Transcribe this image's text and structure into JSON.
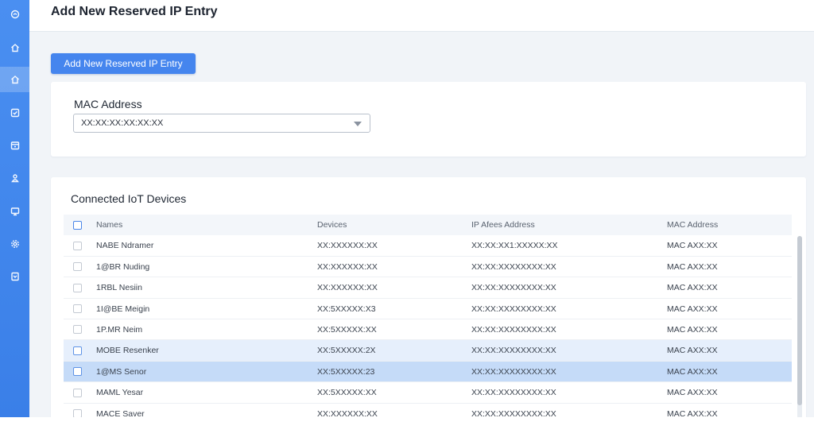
{
  "page": {
    "title": "Add New Reserved IP Entry"
  },
  "sidebar": {
    "items": [
      {
        "icon": "logo-icon"
      },
      {
        "icon": "home-icon"
      },
      {
        "icon": "network-icon",
        "active": true
      },
      {
        "icon": "checkbox-icon"
      },
      {
        "icon": "calendar-icon"
      },
      {
        "icon": "user-icon"
      },
      {
        "icon": "monitor-icon"
      },
      {
        "icon": "gear-icon"
      },
      {
        "icon": "document-icon"
      }
    ]
  },
  "toolbar": {
    "add_label": "Add New Reserved IP Entry"
  },
  "mac_form": {
    "label": "MAC Address",
    "selected_value": "XX:XX:XX:XX:XX:XX"
  },
  "devices": {
    "title": "Connected IoT Devices",
    "columns": [
      "Names",
      "Devices",
      "IP Afees Address",
      "MAC Address"
    ],
    "rows": [
      {
        "name": "NABE Ndramer",
        "device": "XX:XXXXXX:XX",
        "ip": "XX:XX:XX1:XXXXX:XX",
        "mac": "MAC AXX:XX",
        "state": "normal"
      },
      {
        "name": "1@BR Nuding",
        "device": "XX:XXXXXX:XX",
        "ip": "XX:XX:XXXXXXXX:XX",
        "mac": "MAC AXX:XX",
        "state": "normal"
      },
      {
        "name": "1RBL Nesiin",
        "device": "XX:XXXXXX:XX",
        "ip": "XX:XX:XXXXXXXX:XX",
        "mac": "MAC AXX:XX",
        "state": "normal"
      },
      {
        "name": "1I@BE Meigin",
        "device": "XX:5XXXXX:X3",
        "ip": "XX:XX:XXXXXXXX:XX",
        "mac": "MAC AXX:XX",
        "state": "normal"
      },
      {
        "name": "1P.MR Neim",
        "device": "XX:5XXXXX:XX",
        "ip": "XX:XX:XXXXXXXX:XX",
        "mac": "MAC AXX:XX",
        "state": "normal"
      },
      {
        "name": "MOBE Resenker",
        "device": "XX:5XXXXX:2X",
        "ip": "XX:XX:XXXXXXXX:XX",
        "mac": "MAC AXX:XX",
        "state": "selected-light"
      },
      {
        "name": "1@MS Senor",
        "device": "XX:5XXXXX:23",
        "ip": "XX:XX:XXXXXXXX:XX",
        "mac": "MAC AXX:XX",
        "state": "selected-strong"
      },
      {
        "name": "MAML Yesar",
        "device": "XX:5XXXXX:XX",
        "ip": "XX:XX:XXXXXXXX:XX",
        "mac": "MAC AXX:XX",
        "state": "normal"
      },
      {
        "name": "MACE Saver",
        "device": "XX:XXXXXX:XX",
        "ip": "XX:XX:XXXXXXXX:XX",
        "mac": "MAC AXX:XX",
        "state": "normal"
      }
    ]
  },
  "colors": {
    "accent": "#4585ee",
    "sidebar": "#4a8ff1",
    "row_selected_light": "#e6effc",
    "row_selected_strong": "#c5dbf8"
  }
}
